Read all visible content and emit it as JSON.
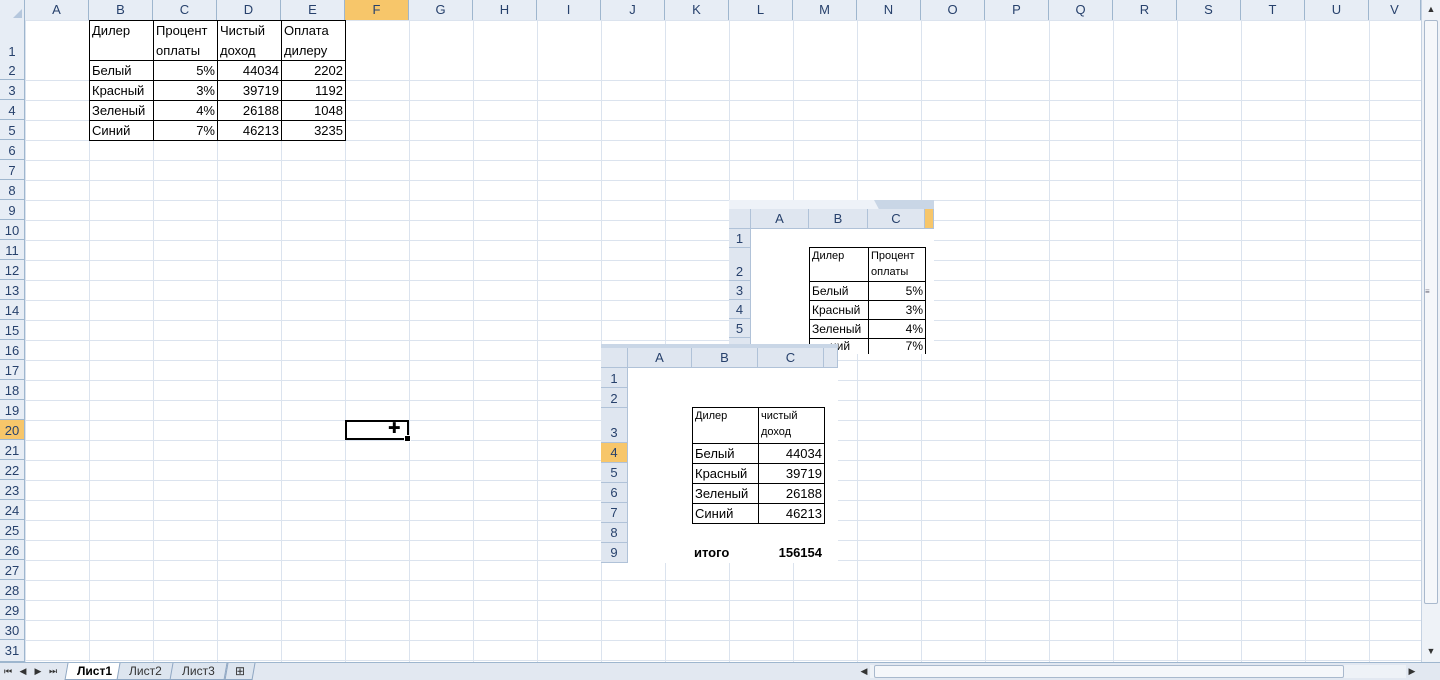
{
  "columns": [
    "A",
    "B",
    "C",
    "D",
    "E",
    "F",
    "G",
    "H",
    "I",
    "J",
    "K",
    "L",
    "M",
    "N",
    "O",
    "P",
    "Q",
    "R",
    "S",
    "T",
    "U",
    "V"
  ],
  "selected_column": "F",
  "rows": [
    "1",
    "2",
    "3",
    "4",
    "5",
    "6",
    "7",
    "8",
    "9",
    "10",
    "11",
    "12",
    "13",
    "14",
    "15",
    "16",
    "17",
    "18",
    "19",
    "20",
    "21",
    "22",
    "23",
    "24",
    "25",
    "26",
    "27",
    "28",
    "29",
    "30",
    "31"
  ],
  "selected_row": "20",
  "table": {
    "headers": {
      "dealer": "Дилер",
      "percent_l1": "Процент",
      "percent_l2": "оплаты",
      "income_l1": "Чистый",
      "income_l2": "доход",
      "pay_l1": "Оплата",
      "pay_l2": "дилеру"
    },
    "rows": [
      {
        "dealer": "Белый",
        "percent": "5%",
        "income": "44034",
        "pay": "2202"
      },
      {
        "dealer": "Красный",
        "percent": "3%",
        "income": "39719",
        "pay": "1192"
      },
      {
        "dealer": "Зеленый",
        "percent": "4%",
        "income": "26188",
        "pay": "1048"
      },
      {
        "dealer": "Синий",
        "percent": "7%",
        "income": "46213",
        "pay": "3235"
      }
    ]
  },
  "image1": {
    "cols": [
      "A",
      "B",
      "C"
    ],
    "rows": [
      "1",
      "2",
      "3",
      "4",
      "5"
    ],
    "dealer": "Дилер",
    "percent_l1": "Процент",
    "percent_l2": "оплаты",
    "data": [
      {
        "dealer": "Белый",
        "percent": "5%"
      },
      {
        "dealer": "Красный",
        "percent": "3%"
      },
      {
        "dealer": "Зеленый",
        "percent": "4%"
      },
      {
        "dealer": "ний",
        "percent": "7%"
      }
    ]
  },
  "image2": {
    "cols": [
      "A",
      "B",
      "C"
    ],
    "rows": [
      "1",
      "2",
      "3",
      "4",
      "5",
      "6",
      "7",
      "8",
      "9"
    ],
    "selected_row": "4",
    "dealer": "Дилер",
    "income_l1": "чистый",
    "income_l2": "доход",
    "data": [
      {
        "dealer": "Белый",
        "income": "44034"
      },
      {
        "dealer": "Красный",
        "income": "39719"
      },
      {
        "dealer": "Зеленый",
        "income": "26188"
      },
      {
        "dealer": "Синий",
        "income": "46213"
      }
    ],
    "total_label": "итого",
    "total_value": "156154"
  },
  "sheets": [
    "Лист1",
    "Лист2",
    "Лист3"
  ],
  "active_sheet": "Лист1"
}
